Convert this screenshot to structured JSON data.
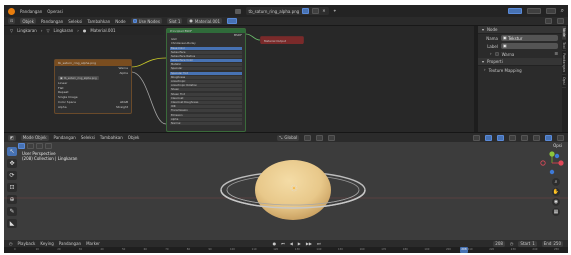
{
  "topbar": {
    "menus": [
      "Pandangan",
      "Operasi"
    ],
    "file_name": "tb_saturn_ring_alpha.png",
    "icons": [
      "blender-logo",
      "image-icon",
      "close-icon",
      "pin-icon"
    ]
  },
  "node_header": {
    "object_label": "Objek",
    "menus": [
      "Pandangan",
      "Seleksi",
      "Tambahkan",
      "Node"
    ],
    "use_nodes_label": "Use Nodes",
    "slot_label": "Slot 1",
    "material_name": "Material.001"
  },
  "breadcrumb": {
    "items": [
      "Lingkaran",
      "Lingkaran",
      "Material.001"
    ]
  },
  "nodes": {
    "image_node": {
      "title": "tb_saturn_ring_alpha.png",
      "outputs": [
        "Warna",
        "Alpha"
      ],
      "rows": [
        "Linear",
        "Flat",
        "Repeat",
        "Single Image",
        "Color Space",
        "sRGB",
        "Alpha",
        "Straight"
      ]
    },
    "bsdf_node": {
      "title": "Principled BSDF",
      "output": "BSDF",
      "rows": [
        "GGX",
        "Christensen-Burley",
        "Base Color",
        "Subsurface",
        "Subsurface Radius",
        "Subsurface Color",
        "Metallic",
        "Specular",
        "Specular Tint",
        "Roughness",
        "Anisotropic",
        "Anisotropic Rotation",
        "Sheen",
        "Sheen Tint",
        "Clearcoat",
        "Clearcoat Roughness",
        "IOR",
        "Transmission",
        "Emission",
        "Alpha",
        "Normal"
      ]
    },
    "output_node": {
      "title": "Material Output"
    }
  },
  "sidebar": {
    "section_label": "Node",
    "name_label": "Nama",
    "name_value": "Tekstur",
    "label_label": "Label",
    "color_label": "Warna",
    "properties_label": "Properti",
    "mapping_label": "Texture Mapping",
    "tabs": [
      "Node",
      "Tool",
      "Pandangan",
      "Opsi"
    ]
  },
  "viewport_header": {
    "mode_label": "Mode Objek",
    "menus": [
      "Pandangan",
      "Seleksi",
      "Tambahkan",
      "Objek"
    ],
    "transform_label": "Global",
    "options_label": "Opsi"
  },
  "viewport": {
    "perspective_label": "User Perspective",
    "collection_label": "(208) Collection | Lingkaran",
    "tools": [
      "cursor",
      "move",
      "rotate",
      "scale",
      "transform",
      "annotate",
      "measure"
    ]
  },
  "timeline": {
    "menus": [
      "Playback",
      "Keying",
      "Pandangan",
      "Marker"
    ],
    "current_frame": "208",
    "start_label": "Start",
    "start_value": "1",
    "end_label": "End",
    "end_value": "250",
    "ticks": [
      "0",
      "10",
      "20",
      "30",
      "40",
      "50",
      "60",
      "70",
      "80",
      "90",
      "100",
      "110",
      "120",
      "130",
      "140",
      "150",
      "160",
      "170",
      "180",
      "190",
      "200",
      "210",
      "220",
      "230",
      "240",
      "250"
    ]
  },
  "colors": {
    "accent": "#4772b3",
    "planet_body": "#e8c88a",
    "ring": "#b9b9b9",
    "socket_yellow": "#c7c729",
    "socket_gray": "#a1a1a1",
    "socket_purple": "#6363c7"
  }
}
